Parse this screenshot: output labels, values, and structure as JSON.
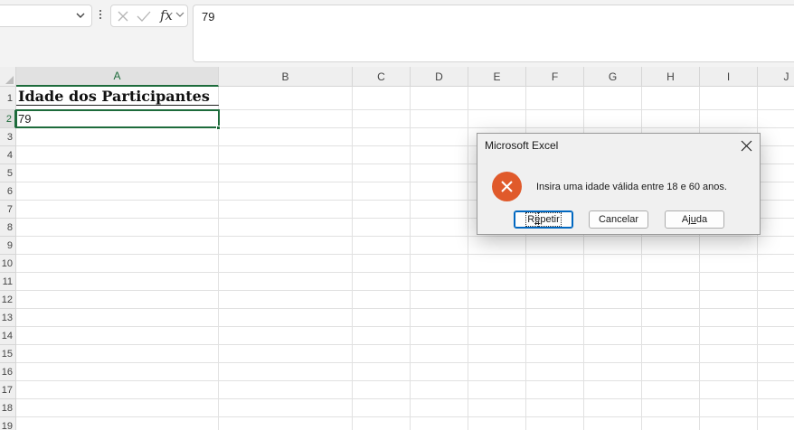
{
  "formula_bar": {
    "name_box_value": "",
    "formula_value": "79"
  },
  "grid": {
    "columns": [
      "A",
      "B",
      "C",
      "D",
      "E",
      "F",
      "G",
      "H",
      "I",
      "J"
    ],
    "rows": [
      "1",
      "2",
      "3",
      "4",
      "5",
      "6",
      "7",
      "8",
      "9",
      "10",
      "11",
      "12",
      "13",
      "14",
      "15",
      "16",
      "17",
      "18",
      "19"
    ],
    "cells": {
      "A1": "Idade dos Participantes",
      "A2": "79"
    },
    "active_cell": "A2"
  },
  "dialog": {
    "title": "Microsoft Excel",
    "message": "Insira uma idade válida entre 18 e 60 anos.",
    "buttons": {
      "retry_prefix": "R",
      "retry_underline": "e",
      "retry_suffix": "petir",
      "cancel": "Cancelar",
      "help_prefix": "Aj",
      "help_underline": "u",
      "help_suffix": "da"
    }
  },
  "colors": {
    "accent_green": "#1d6b3b",
    "error_icon": "#e05a2b",
    "default_button_border": "#0067c0"
  }
}
